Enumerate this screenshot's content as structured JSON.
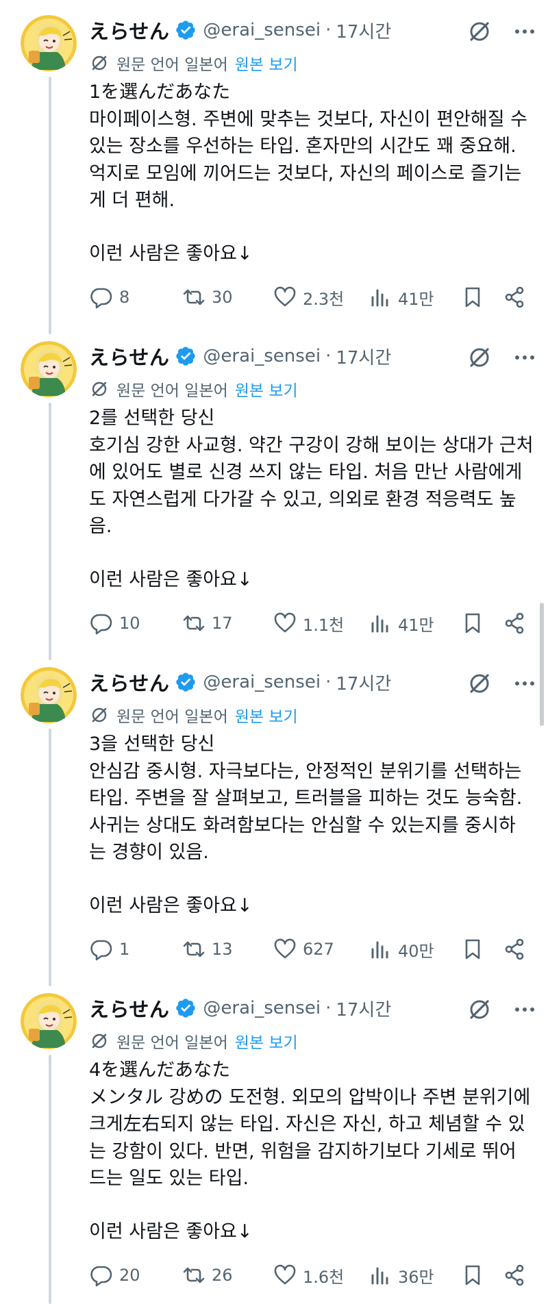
{
  "colors": {
    "accent": "#1d9bf0",
    "secondary_text": "#536471",
    "thread_line": "#cfd9de",
    "verified_badge": "#1d9bf0"
  },
  "icons": {
    "reply": "speech-bubble",
    "retweet": "retweet-arrows",
    "like": "heart",
    "views": "bar-chart",
    "bookmark": "bookmark",
    "share": "share",
    "grok": "grok-slash-circle",
    "more": "three-dots",
    "translate": "translate-slash-circle",
    "verified": "verified-badge"
  },
  "tweets": [
    {
      "display_name": "えらせん",
      "handle": "@erai_sensei",
      "separator": "·",
      "timestamp": "17시간",
      "translate_label": "원문 언어 일본어",
      "show_original": "원본 보기",
      "lines": [
        "1を選んだあなた",
        "마이페이스형. 주변에 맞추는 것보다, 자신이 편안해질 수",
        "있는 장소를 우선하는 타입. 혼자만의 시간도 꽤 중요해.",
        "억지로 모임에 끼어드는 것보다, 자신의 페이스로 즐기는",
        "게 더 편해."
      ],
      "footer": "이런 사람은 좋아요↓",
      "stats": {
        "replies": "8",
        "retweets": "30",
        "likes": "2.3천",
        "views": "41만"
      }
    },
    {
      "display_name": "えらせん",
      "handle": "@erai_sensei",
      "separator": "·",
      "timestamp": "17시간",
      "translate_label": "원문 언어 일본어",
      "show_original": "원본 보기",
      "lines": [
        "2를 선택한 당신",
        "호기심 강한 사교형. 약간 구강이 강해 보이는 상대가 근처",
        "에 있어도 별로 신경 쓰지 않는 타입. 처음 만난 사람에게",
        "도 자연스럽게 다가갈 수 있고, 의외로 환경 적응력도 높",
        "음."
      ],
      "footer": "이런 사람은 좋아요↓",
      "stats": {
        "replies": "10",
        "retweets": "17",
        "likes": "1.1천",
        "views": "41만"
      }
    },
    {
      "display_name": "えらせん",
      "handle": "@erai_sensei",
      "separator": "·",
      "timestamp": "17시간",
      "translate_label": "원문 언어 일본어",
      "show_original": "원본 보기",
      "lines": [
        "3을 선택한 당신",
        "안심감 중시형. 자극보다는, 안정적인 분위기를 선택하는",
        "타입. 주변을 잘 살펴보고, 트러블을 피하는 것도 능숙함.",
        "사귀는 상대도 화려함보다는 안심할 수 있는지를 중시하",
        "는 경향이 있음."
      ],
      "footer": "이런 사람은 좋아요↓",
      "stats": {
        "replies": "1",
        "retweets": "13",
        "likes": "627",
        "views": "40만"
      }
    },
    {
      "display_name": "えらせん",
      "handle": "@erai_sensei",
      "separator": "·",
      "timestamp": "17시간",
      "translate_label": "원문 언어 일본어",
      "show_original": "원본 보기",
      "lines": [
        "4を選んだあなた",
        "メンタル 강めの 도전형. 외모의 압박이나 주변 분위기에",
        "크게左右되지 않는 타입. 자신은 자신, 하고 체념할 수 있",
        "는 강함이 있다. 반면, 위험을 감지하기보다 기세로 뛰어",
        "드는 일도 있는 타입."
      ],
      "footer": "이런 사람은 좋아요↓",
      "stats": {
        "replies": "20",
        "retweets": "26",
        "likes": "1.6천",
        "views": "36만"
      }
    }
  ]
}
